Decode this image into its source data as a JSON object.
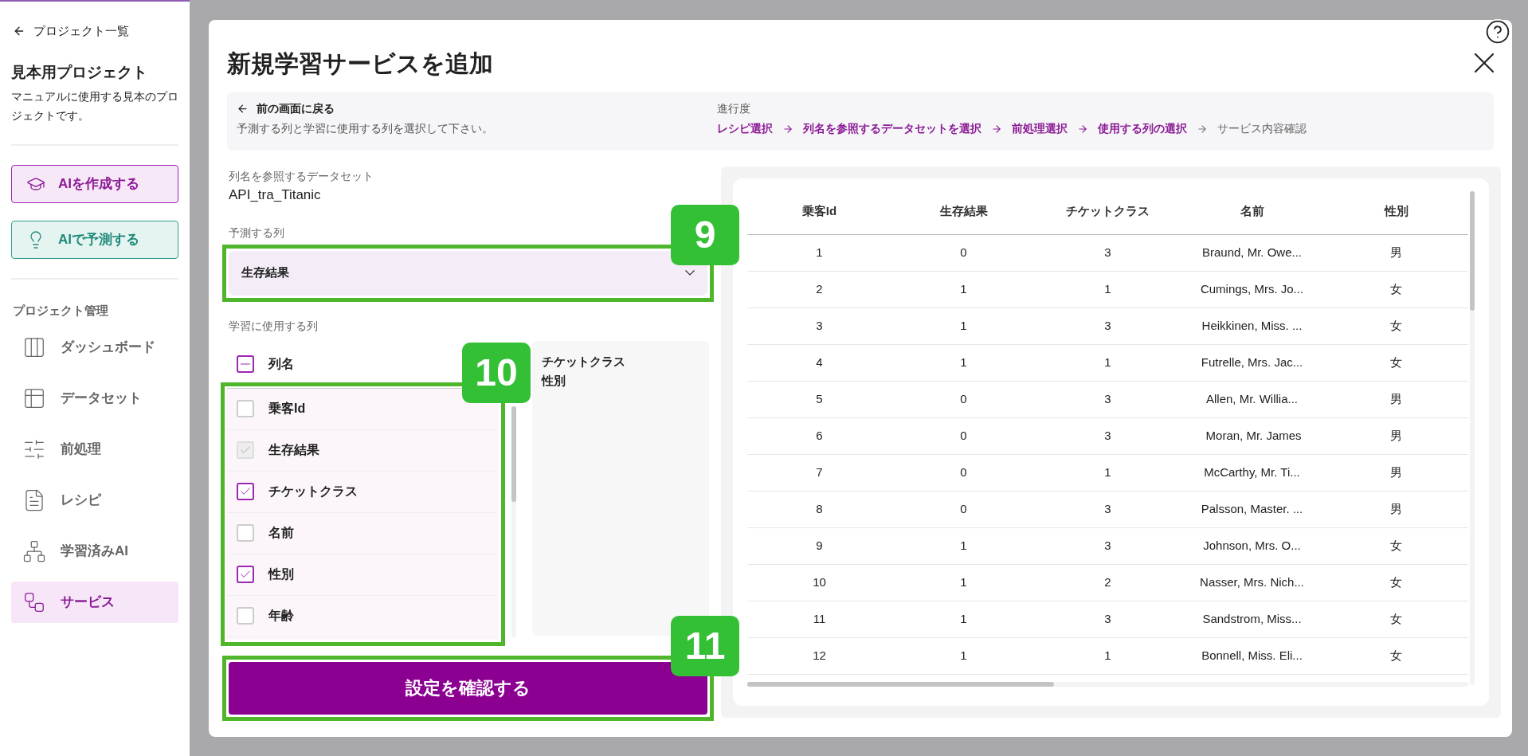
{
  "sidebar": {
    "back_link": "プロジェクト一覧",
    "project_title": "見本用プロジェクト",
    "project_description": "マニュアルに使用する見本のプロジェクトです。",
    "actions": [
      {
        "label": "AIを作成する",
        "kind": "create"
      },
      {
        "label": "AIで予測する",
        "kind": "predict"
      }
    ],
    "section_title": "プロジェクト管理",
    "items": [
      {
        "label": "ダッシュボード",
        "kind": "dashboard",
        "selected": false
      },
      {
        "label": "データセット",
        "kind": "dataset",
        "selected": false
      },
      {
        "label": "前処理",
        "kind": "preprocess",
        "selected": false
      },
      {
        "label": "レシピ",
        "kind": "recipe",
        "selected": false
      },
      {
        "label": "学習済みAI",
        "kind": "trained",
        "selected": false
      },
      {
        "label": "サービス",
        "kind": "service",
        "selected": true
      }
    ]
  },
  "dialog": {
    "title": "新規学習サービスを追加",
    "back_link": "前の画面に戻る",
    "instruction": "予測する列と学習に使用する列を選択して下さい。",
    "progress_label": "進行度",
    "steps": [
      {
        "label": "レシピ選択",
        "done": true
      },
      {
        "label": "列名を参照するデータセットを選択",
        "done": true
      },
      {
        "label": "前処理選択",
        "done": true
      },
      {
        "label": "使用する列の選択",
        "done": true
      },
      {
        "label": "サービス内容確認",
        "done": false
      }
    ],
    "dataset_label": "列名を参照するデータセット",
    "dataset_name": "API_tra_Titanic",
    "target_label": "予測する列",
    "target_value": "生存結果",
    "target_annotation": "9",
    "features_label": "学習に使用する列",
    "column_list": {
      "header": "列名",
      "indeterminate": true,
      "annotation": "10",
      "items": [
        {
          "label": "乗客Id",
          "checked": false,
          "disabled": false
        },
        {
          "label": "生存結果",
          "checked": true,
          "disabled": true
        },
        {
          "label": "チケットクラス",
          "checked": true,
          "disabled": false
        },
        {
          "label": "名前",
          "checked": false,
          "disabled": false
        },
        {
          "label": "性別",
          "checked": true,
          "disabled": false
        },
        {
          "label": "年齢",
          "checked": false,
          "disabled": false
        }
      ]
    },
    "selected_columns": [
      "チケットクラス",
      "性別"
    ],
    "confirm_button": "設定を確認する",
    "confirm_annotation": "11",
    "table": {
      "columns": [
        "乗客Id",
        "生存結果",
        "チケットクラス",
        "名前",
        "性別"
      ],
      "rows": [
        [
          "1",
          "0",
          "3",
          "Braund, Mr. Owe...",
          "男"
        ],
        [
          "2",
          "1",
          "1",
          "Cumings, Mrs. Jo...",
          "女"
        ],
        [
          "3",
          "1",
          "3",
          "Heikkinen, Miss. ...",
          "女"
        ],
        [
          "4",
          "1",
          "1",
          "Futrelle, Mrs. Jac...",
          "女"
        ],
        [
          "5",
          "0",
          "3",
          "Allen, Mr. Willia...",
          "男"
        ],
        [
          "6",
          "0",
          "3",
          " Moran, Mr. James",
          "男"
        ],
        [
          "7",
          "0",
          "1",
          "McCarthy, Mr. Ti...",
          "男"
        ],
        [
          "8",
          "0",
          "3",
          "Palsson, Master. ...",
          "男"
        ],
        [
          "9",
          "1",
          "3",
          "Johnson, Mrs. O...",
          "女"
        ],
        [
          "10",
          "1",
          "2",
          "Nasser, Mrs. Nich...",
          "女"
        ],
        [
          "11",
          "1",
          "3",
          "Sandstrom, Miss...",
          "女"
        ],
        [
          "12",
          "1",
          "1",
          "Bonnell, Miss. Eli...",
          "女"
        ]
      ]
    }
  }
}
